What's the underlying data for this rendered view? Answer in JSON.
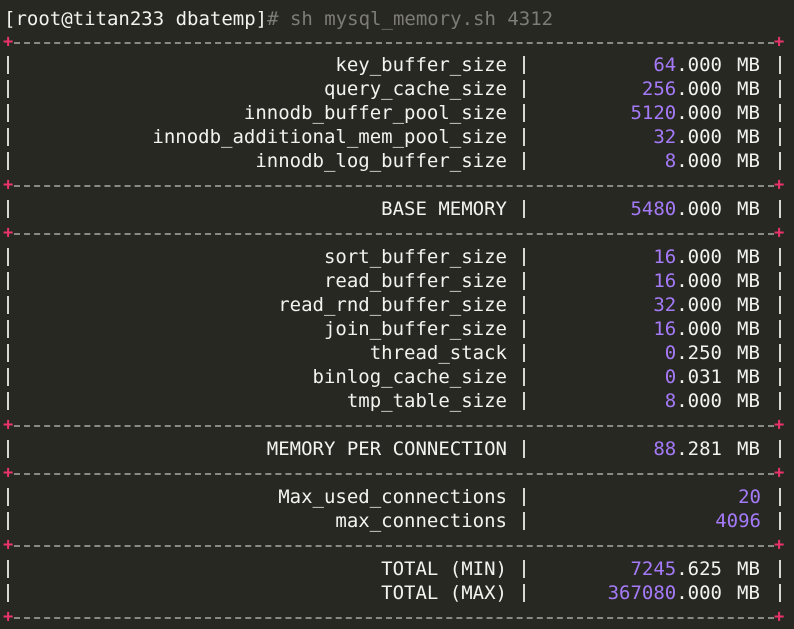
{
  "terminal": {
    "prompt": "[root@titan233 dbatemp]",
    "command": "# sh mysql_memory.sh 4312"
  },
  "colors": {
    "background": "#272822",
    "text": "#f2f2ee",
    "value": "#a57af8",
    "separator_plus": "#e8336b",
    "command": "#7d7d76"
  },
  "rows": {
    "key_buffer_size": {
      "label": "key_buffer_size",
      "int": "64",
      "frac": ".000",
      "unit": "MB"
    },
    "query_cache_size": {
      "label": "query_cache_size",
      "int": "256",
      "frac": ".000",
      "unit": "MB"
    },
    "innodb_buffer_pool_size": {
      "label": "innodb_buffer_pool_size",
      "int": "5120",
      "frac": ".000",
      "unit": "MB"
    },
    "innodb_additional_mem_pool_size": {
      "label": "innodb_additional_mem_pool_size",
      "int": "32",
      "frac": ".000",
      "unit": "MB"
    },
    "innodb_log_buffer_size": {
      "label": "innodb_log_buffer_size",
      "int": "8",
      "frac": ".000",
      "unit": "MB"
    },
    "base_memory": {
      "label": "BASE MEMORY",
      "int": "5480",
      "frac": ".000",
      "unit": "MB"
    },
    "sort_buffer_size": {
      "label": "sort_buffer_size",
      "int": "16",
      "frac": ".000",
      "unit": "MB"
    },
    "read_buffer_size": {
      "label": "read_buffer_size",
      "int": "16",
      "frac": ".000",
      "unit": "MB"
    },
    "read_rnd_buffer_size": {
      "label": "read_rnd_buffer_size",
      "int": "32",
      "frac": ".000",
      "unit": "MB"
    },
    "join_buffer_size": {
      "label": "join_buffer_size",
      "int": "16",
      "frac": ".000",
      "unit": "MB"
    },
    "thread_stack": {
      "label": "thread_stack",
      "int": "0",
      "frac": ".250",
      "unit": "MB"
    },
    "binlog_cache_size": {
      "label": "binlog_cache_size",
      "int": "0",
      "frac": ".031",
      "unit": "MB"
    },
    "tmp_table_size": {
      "label": "tmp_table_size",
      "int": "8",
      "frac": ".000",
      "unit": "MB"
    },
    "memory_per_connection": {
      "label": "MEMORY PER CONNECTION",
      "int": "88",
      "frac": ".281",
      "unit": "MB"
    },
    "max_used_connections": {
      "label": "Max_used_connections",
      "int": "20"
    },
    "max_connections": {
      "label": "max_connections",
      "int": "4096"
    },
    "total_min": {
      "label": "TOTAL (MIN)",
      "int": "7245",
      "frac": ".625",
      "unit": "MB"
    },
    "total_max": {
      "label": "TOTAL (MAX)",
      "int": "367080",
      "frac": ".000",
      "unit": "MB"
    }
  }
}
